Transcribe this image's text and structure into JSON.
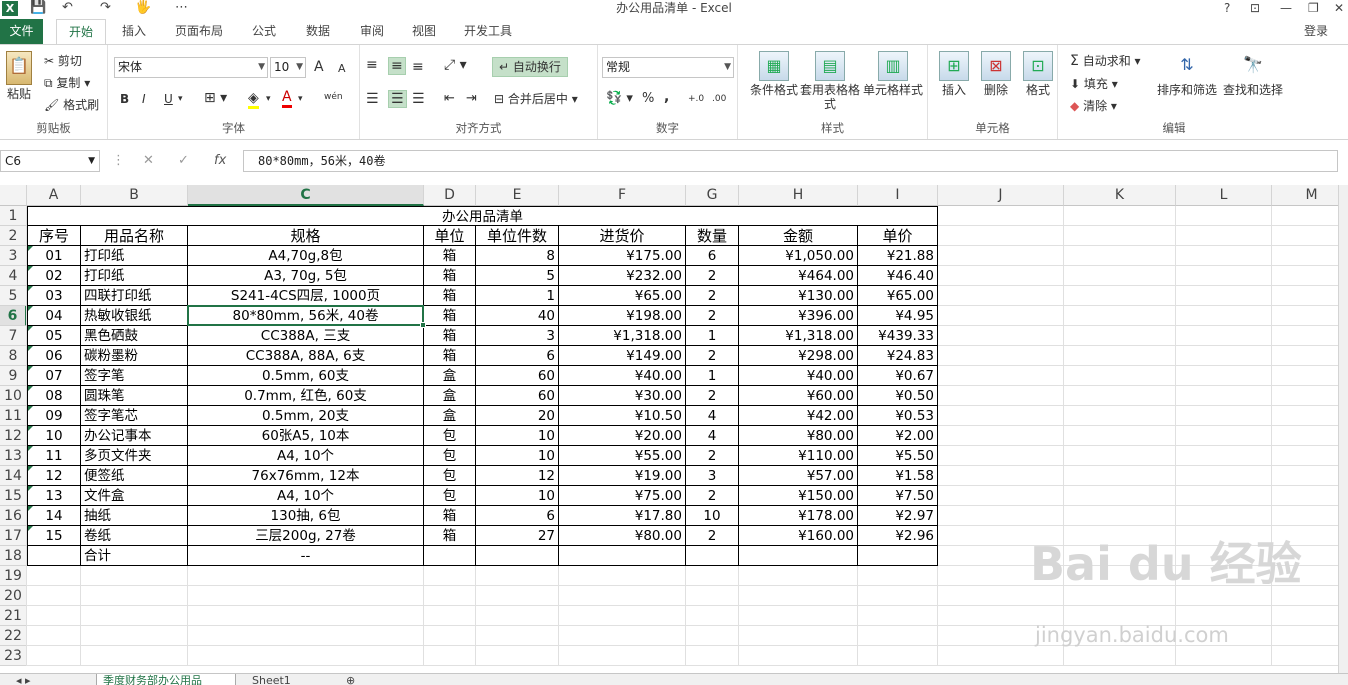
{
  "window": {
    "title": "办公用品清单 - Excel",
    "controls": [
      "?",
      "⊡",
      "—",
      "❐",
      "✕"
    ],
    "login": "登录",
    "qat": [
      "💾",
      "↶",
      "↷",
      "🖐",
      "⋯"
    ]
  },
  "tabs": [
    "文件",
    "开始",
    "插入",
    "页面布局",
    "公式",
    "数据",
    "审阅",
    "视图",
    "开发工具"
  ],
  "ribbon": {
    "clipboard": {
      "label": "剪贴板",
      "paste": "粘贴",
      "cut": "剪切",
      "copy": "复制",
      "painter": "格式刷"
    },
    "font": {
      "label": "字体",
      "name": "宋体",
      "size": "10",
      "bold": "B",
      "italic": "I",
      "underline": "U",
      "grow": "A",
      "shrink": "A",
      "wen": "wén"
    },
    "align": {
      "label": "对齐方式",
      "wrap": "自动换行",
      "merge": "合并后居中"
    },
    "number": {
      "label": "数字",
      "format": "常规",
      "percent": "%",
      "comma": ","
    },
    "styles": {
      "label": "样式",
      "cond": "条件格式",
      "table": "套用表格格式",
      "cell": "单元格样式"
    },
    "cells": {
      "label": "单元格",
      "insert": "插入",
      "delete": "删除",
      "format": "格式"
    },
    "edit": {
      "label": "编辑",
      "autosum": "自动求和",
      "fill": "填充",
      "clear": "清除",
      "sort": "排序和筛选",
      "find": "查找和选择"
    }
  },
  "formula_bar": {
    "name_box": "C6",
    "fx": "fx",
    "cancel": "✕",
    "enter": "✓",
    "value": "80*80mm，56米，40卷"
  },
  "columns": [
    "A",
    "B",
    "C",
    "D",
    "E",
    "F",
    "G",
    "H",
    "I",
    "J",
    "K",
    "L",
    "M"
  ],
  "row_numbers": [
    "1",
    "2",
    "3",
    "4",
    "5",
    "6",
    "7",
    "8",
    "9",
    "10",
    "11",
    "12",
    "13",
    "14",
    "15",
    "16",
    "17",
    "18",
    "19",
    "20",
    "21",
    "22",
    "23"
  ],
  "sheet_title": "办公用品清单",
  "headers": [
    "序号",
    "用品名称",
    "规格",
    "单位",
    "单位件数",
    "进货价",
    "数量",
    "金额",
    "单价"
  ],
  "rows": [
    [
      "01",
      "打印纸",
      "A4,70g,8包",
      "箱",
      "8",
      "¥175.00",
      "6",
      "¥1,050.00",
      "¥21.88"
    ],
    [
      "02",
      "打印纸",
      "A3, 70g, 5包",
      "箱",
      "5",
      "¥232.00",
      "2",
      "¥464.00",
      "¥46.40"
    ],
    [
      "03",
      "四联打印纸",
      "S241-4CS四层, 1000页",
      "箱",
      "1",
      "¥65.00",
      "2",
      "¥130.00",
      "¥65.00"
    ],
    [
      "04",
      "热敏收银纸",
      "80*80mm, 56米, 40卷",
      "箱",
      "40",
      "¥198.00",
      "2",
      "¥396.00",
      "¥4.95"
    ],
    [
      "05",
      "黑色硒鼓",
      "CC388A, 三支",
      "箱",
      "3",
      "¥1,318.00",
      "1",
      "¥1,318.00",
      "¥439.33"
    ],
    [
      "06",
      "碳粉墨粉",
      "CC388A, 88A, 6支",
      "箱",
      "6",
      "¥149.00",
      "2",
      "¥298.00",
      "¥24.83"
    ],
    [
      "07",
      "签字笔",
      "0.5mm, 60支",
      "盒",
      "60",
      "¥40.00",
      "1",
      "¥40.00",
      "¥0.67"
    ],
    [
      "08",
      "圆珠笔",
      "0.7mm, 红色, 60支",
      "盒",
      "60",
      "¥30.00",
      "2",
      "¥60.00",
      "¥0.50"
    ],
    [
      "09",
      "签字笔芯",
      "0.5mm, 20支",
      "盒",
      "20",
      "¥10.50",
      "4",
      "¥42.00",
      "¥0.53"
    ],
    [
      "10",
      "办公记事本",
      "60张A5, 10本",
      "包",
      "10",
      "¥20.00",
      "4",
      "¥80.00",
      "¥2.00"
    ],
    [
      "11",
      "多页文件夹",
      "A4, 10个",
      "包",
      "10",
      "¥55.00",
      "2",
      "¥110.00",
      "¥5.50"
    ],
    [
      "12",
      "便签纸",
      "76x76mm, 12本",
      "包",
      "12",
      "¥19.00",
      "3",
      "¥57.00",
      "¥1.58"
    ],
    [
      "13",
      "文件盒",
      "A4, 10个",
      "包",
      "10",
      "¥75.00",
      "2",
      "¥150.00",
      "¥7.50"
    ],
    [
      "14",
      "抽纸",
      "130抽, 6包",
      "箱",
      "6",
      "¥17.80",
      "10",
      "¥178.00",
      "¥2.97"
    ],
    [
      "15",
      "卷纸",
      "三层200g, 27卷",
      "箱",
      "27",
      "¥80.00",
      "2",
      "¥160.00",
      "¥2.96"
    ]
  ],
  "total_row": [
    "",
    "合计",
    "--",
    "",
    "",
    "",
    "",
    "",
    ""
  ],
  "sheet_tabs": [
    "季度财务部办公用品",
    "Sheet1"
  ],
  "watermark": {
    "main": "Bai du 经验",
    "sub": "jingyan.baidu.com"
  }
}
